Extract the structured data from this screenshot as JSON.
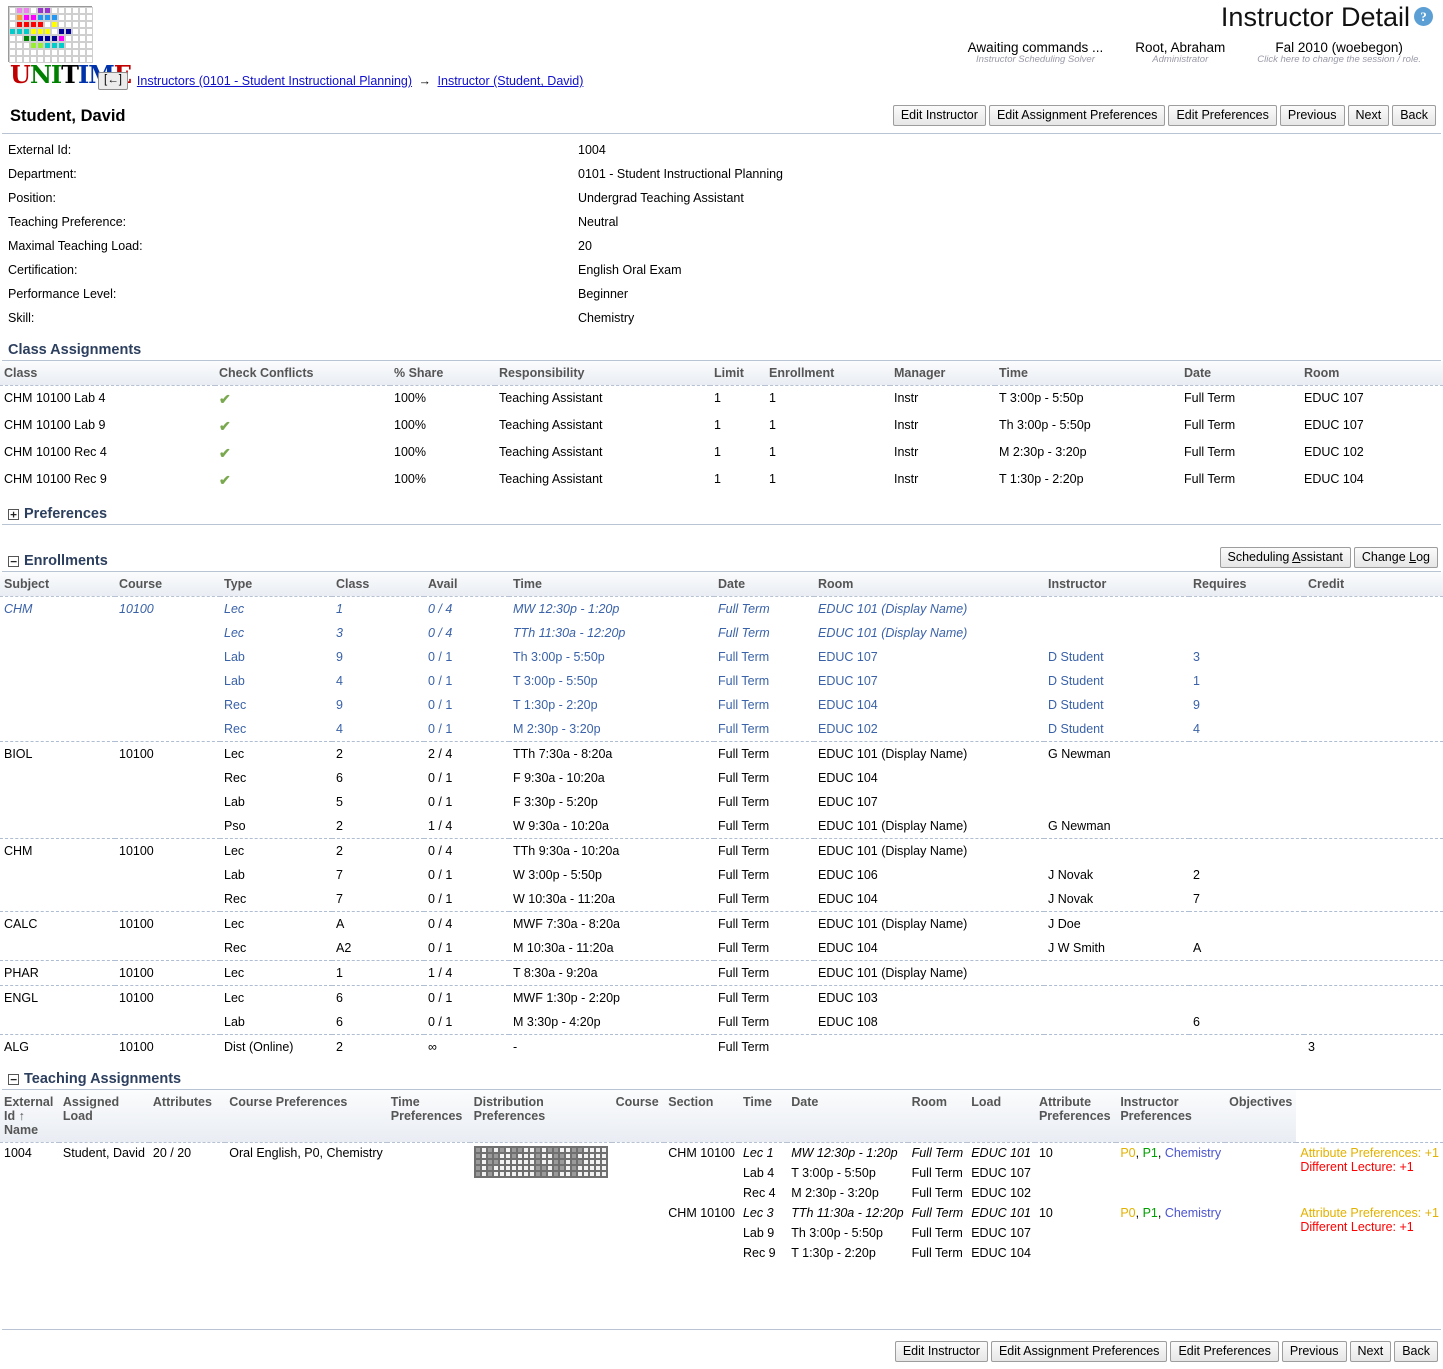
{
  "header": {
    "title": "Instructor Detail",
    "help_icon": "question-mark-icon",
    "status": [
      {
        "main": "Awaiting commands ...",
        "sub": "Instructor Scheduling Solver"
      },
      {
        "main": "Root, Abraham",
        "sub": "Administrator"
      },
      {
        "main": "Fal 2010 (woebegon)",
        "sub": "Click here to change the session / role."
      }
    ],
    "back_button": "[←]",
    "breadcrumb": {
      "first": "Instructors (0101 - Student Instructional Planning)",
      "arrow": "→",
      "second": "Instructor (Student, David)"
    },
    "logo_word": {
      "u": "U",
      "ni": "NI",
      "t": "T",
      "im": "IM",
      "e": "E"
    }
  },
  "person": {
    "name": "Student, David"
  },
  "toolbar": {
    "edit_instructor": "Edit Instructor",
    "edit_assignment_preferences": "Edit Assignment Preferences",
    "edit_preferences": "Edit Preferences",
    "previous": "Previous",
    "next": "Next",
    "back": "Back"
  },
  "properties": [
    {
      "key": "External Id:",
      "value": "1004"
    },
    {
      "key": "Department:",
      "value": "0101 - Student Instructional Planning"
    },
    {
      "key": "Position:",
      "value": "Undergrad Teaching Assistant"
    },
    {
      "key": "Teaching Preference:",
      "value": "Neutral"
    },
    {
      "key": "Maximal Teaching Load:",
      "value": "20"
    },
    {
      "key": "Certification:",
      "value": "English Oral Exam"
    },
    {
      "key": "Performance Level:",
      "value": "Beginner"
    },
    {
      "key": "Skill:",
      "value": "Chemistry"
    }
  ],
  "class_assignments": {
    "section_title": "Class Assignments",
    "columns": [
      "Class",
      "Check Conflicts",
      "% Share",
      "Responsibility",
      "Limit",
      "Enrollment",
      "Manager",
      "Time",
      "Date",
      "Room"
    ],
    "rows": [
      {
        "class": "CHM 10100 Lab 4",
        "conflict": "check-icon",
        "share": "100%",
        "responsibility": "Teaching Assistant",
        "limit": "1",
        "enrollment": "1",
        "manager": "Instr",
        "time": "T 3:00p - 5:50p",
        "date": "Full Term",
        "room": "EDUC 107"
      },
      {
        "class": "CHM 10100 Lab 9",
        "conflict": "check-icon",
        "share": "100%",
        "responsibility": "Teaching Assistant",
        "limit": "1",
        "enrollment": "1",
        "manager": "Instr",
        "time": "Th 3:00p - 5:50p",
        "date": "Full Term",
        "room": "EDUC 107"
      },
      {
        "class": "CHM 10100 Rec 4",
        "conflict": "check-icon",
        "share": "100%",
        "responsibility": "Teaching Assistant",
        "limit": "1",
        "enrollment": "1",
        "manager": "Instr",
        "time": "M 2:30p - 3:20p",
        "date": "Full Term",
        "room": "EDUC 102"
      },
      {
        "class": "CHM 10100 Rec 9",
        "conflict": "check-icon",
        "share": "100%",
        "responsibility": "Teaching Assistant",
        "limit": "1",
        "enrollment": "1",
        "manager": "Instr",
        "time": "T 1:30p - 2:20p",
        "date": "Full Term",
        "room": "EDUC 104"
      }
    ]
  },
  "preferences": {
    "section_title": "Preferences",
    "toggle": "+"
  },
  "enrollments": {
    "section_title": "Enrollments",
    "toggle": "−",
    "scheduling_assistant": "Scheduling Assistant",
    "change_log": "Change Log",
    "columns": [
      "Subject",
      "Course",
      "Type",
      "Class",
      "Avail",
      "Time",
      "Date",
      "Room",
      "Instructor",
      "Requires",
      "Credit"
    ],
    "rows": [
      {
        "group": true,
        "link": true,
        "italic": true,
        "subject": "CHM",
        "course": "10100",
        "type": "Lec",
        "class": "1",
        "avail": "0 / 4",
        "time": "MW 12:30p - 1:20p",
        "date": "Full Term",
        "room": "EDUC 101 (Display Name)",
        "instructor": "",
        "requires": "",
        "credit": ""
      },
      {
        "group": false,
        "link": true,
        "italic": true,
        "subject": "",
        "course": "",
        "type": "Lec",
        "class": "3",
        "avail": "0 / 4",
        "time": "TTh 11:30a - 12:20p",
        "date": "Full Term",
        "room": "EDUC 101 (Display Name)",
        "instructor": "",
        "requires": "",
        "credit": ""
      },
      {
        "group": false,
        "link": true,
        "italic": false,
        "subject": "",
        "course": "",
        "type": "Lab",
        "class": "9",
        "avail": "0 / 1",
        "time": "Th 3:00p - 5:50p",
        "date": "Full Term",
        "room": "EDUC 107",
        "instructor": "D Student",
        "requires": "3",
        "credit": ""
      },
      {
        "group": false,
        "link": true,
        "italic": false,
        "subject": "",
        "course": "",
        "type": "Lab",
        "class": "4",
        "avail": "0 / 1",
        "time": "T 3:00p - 5:50p",
        "date": "Full Term",
        "room": "EDUC 107",
        "instructor": "D Student",
        "requires": "1",
        "credit": ""
      },
      {
        "group": false,
        "link": true,
        "italic": false,
        "subject": "",
        "course": "",
        "type": "Rec",
        "class": "9",
        "avail": "0 / 1",
        "time": "T 1:30p - 2:20p",
        "date": "Full Term",
        "room": "EDUC 104",
        "instructor": "D Student",
        "requires": "9",
        "credit": ""
      },
      {
        "group": false,
        "link": true,
        "italic": false,
        "subject": "",
        "course": "",
        "type": "Rec",
        "class": "4",
        "avail": "0 / 1",
        "time": "M 2:30p - 3:20p",
        "date": "Full Term",
        "room": "EDUC 102",
        "instructor": "D Student",
        "requires": "4",
        "credit": ""
      },
      {
        "group": true,
        "link": false,
        "italic": false,
        "subject": "BIOL",
        "course": "10100",
        "type": "Lec",
        "class": "2",
        "avail": "2 / 4",
        "time": "TTh 7:30a - 8:20a",
        "date": "Full Term",
        "room": "EDUC 101 (Display Name)",
        "instructor": "G Newman",
        "requires": "",
        "credit": ""
      },
      {
        "group": false,
        "link": false,
        "italic": false,
        "subject": "",
        "course": "",
        "type": "Rec",
        "class": "6",
        "avail": "0 / 1",
        "time": "F 9:30a - 10:20a",
        "date": "Full Term",
        "room": "EDUC 104",
        "instructor": "",
        "requires": "",
        "credit": ""
      },
      {
        "group": false,
        "link": false,
        "italic": false,
        "subject": "",
        "course": "",
        "type": "Lab",
        "class": "5",
        "avail": "0 / 1",
        "time": "F 3:30p - 5:20p",
        "date": "Full Term",
        "room": "EDUC 107",
        "instructor": "",
        "requires": "",
        "credit": ""
      },
      {
        "group": false,
        "link": false,
        "italic": false,
        "subject": "",
        "course": "",
        "type": "Pso",
        "class": "2",
        "avail": "1 / 4",
        "time": "W 9:30a - 10:20a",
        "date": "Full Term",
        "room": "EDUC 101 (Display Name)",
        "instructor": "G Newman",
        "requires": "",
        "credit": ""
      },
      {
        "group": true,
        "link": false,
        "italic": false,
        "subject": "CHM",
        "course": "10100",
        "type": "Lec",
        "class": "2",
        "avail": "0 / 4",
        "time": "TTh 9:30a - 10:20a",
        "date": "Full Term",
        "room": "EDUC 101 (Display Name)",
        "instructor": "",
        "requires": "",
        "credit": ""
      },
      {
        "group": false,
        "link": false,
        "italic": false,
        "subject": "",
        "course": "",
        "type": "Lab",
        "class": "7",
        "avail": "0 / 1",
        "time": "W 3:00p - 5:50p",
        "date": "Full Term",
        "room": "EDUC 106",
        "instructor": "J Novak",
        "requires": "2",
        "credit": ""
      },
      {
        "group": false,
        "link": false,
        "italic": false,
        "subject": "",
        "course": "",
        "type": "Rec",
        "class": "7",
        "avail": "0 / 1",
        "time": "W 10:30a - 11:20a",
        "date": "Full Term",
        "room": "EDUC 104",
        "instructor": "J Novak",
        "requires": "7",
        "credit": ""
      },
      {
        "group": true,
        "link": false,
        "italic": false,
        "subject": "CALC",
        "course": "10100",
        "type": "Lec",
        "class": "A",
        "avail": "0 / 4",
        "time": "MWF 7:30a - 8:20a",
        "date": "Full Term",
        "room": "EDUC 101 (Display Name)",
        "instructor": "J Doe",
        "requires": "",
        "credit": ""
      },
      {
        "group": false,
        "link": false,
        "italic": false,
        "subject": "",
        "course": "",
        "type": "Rec",
        "class": "A2",
        "avail": "0 / 1",
        "time": "M 10:30a - 11:20a",
        "date": "Full Term",
        "room": "EDUC 104",
        "instructor": "J W Smith",
        "requires": "A",
        "credit": ""
      },
      {
        "group": true,
        "link": false,
        "italic": false,
        "subject": "PHAR",
        "course": "10100",
        "type": "Lec",
        "class": "1",
        "avail": "1 / 4",
        "time": "T 8:30a - 9:20a",
        "date": "Full Term",
        "room": "EDUC 101 (Display Name)",
        "instructor": "",
        "requires": "",
        "credit": ""
      },
      {
        "group": true,
        "link": false,
        "italic": false,
        "subject": "ENGL",
        "course": "10100",
        "type": "Lec",
        "class": "6",
        "avail": "0 / 1",
        "time": "MWF 1:30p - 2:20p",
        "date": "Full Term",
        "room": "EDUC 103",
        "instructor": "",
        "requires": "",
        "credit": ""
      },
      {
        "group": false,
        "link": false,
        "italic": false,
        "subject": "",
        "course": "",
        "type": "Lab",
        "class": "6",
        "avail": "0 / 1",
        "time": "M 3:30p - 4:20p",
        "date": "Full Term",
        "room": "EDUC 108",
        "instructor": "",
        "requires": "6",
        "credit": ""
      },
      {
        "group": true,
        "link": false,
        "italic": false,
        "subject": "ALG",
        "course": "10100",
        "type": "Dist (Online)",
        "class": "2",
        "avail": "∞",
        "time": "-",
        "date": "Full Term",
        "room": "",
        "instructor": "",
        "requires": "",
        "credit": "3"
      }
    ]
  },
  "teaching_assignments": {
    "section_title": "Teaching Assignments",
    "toggle": "−",
    "columns": [
      "External Id ↑ Name",
      "Assigned Load",
      "Attributes",
      "Course Preferences",
      "Time Preferences",
      "Distribution Preferences",
      "Course",
      "Section",
      "Time",
      "Date",
      "Room",
      "Load",
      "Attribute Preferences",
      "Instructor Preferences",
      "Objectives"
    ],
    "external_id": "1004",
    "name": "Student, David",
    "assigned_load": "20 / 20",
    "attributes": "Oral English, P0, Chemistry",
    "course_preferences": "",
    "distribution_preferences": "",
    "instructor_preferences": "",
    "time_pref_grid": {
      "rows": 5,
      "cols": 22,
      "pattern": [
        [
          1,
          0,
          1,
          0,
          1,
          0,
          1,
          1,
          0,
          0,
          1,
          0,
          1,
          1,
          0,
          0,
          1,
          1,
          0,
          0,
          0,
          0
        ],
        [
          1,
          0,
          1,
          1,
          0,
          0,
          1,
          0,
          0,
          0,
          1,
          0,
          0,
          1,
          1,
          0,
          1,
          0,
          0,
          0,
          0,
          0
        ],
        [
          1,
          0,
          1,
          1,
          0,
          0,
          0,
          0,
          0,
          0,
          1,
          0,
          0,
          1,
          1,
          0,
          1,
          1,
          0,
          0,
          0,
          0
        ],
        [
          1,
          0,
          1,
          0,
          0,
          0,
          0,
          0,
          0,
          0,
          1,
          1,
          0,
          1,
          1,
          0,
          1,
          0,
          0,
          0,
          0,
          0
        ],
        [
          1,
          0,
          1,
          0,
          0,
          0,
          0,
          0,
          0,
          0,
          1,
          1,
          0,
          1,
          0,
          0,
          1,
          0,
          0,
          0,
          0,
          0
        ]
      ]
    },
    "groups": [
      {
        "course": "CHM 10100",
        "load": "10",
        "attribute_preferences": [
          {
            "text": "P0",
            "color": "#e3b200"
          },
          {
            "text": "P1",
            "color": "#00a000"
          },
          {
            "text": "Chemistry",
            "color": "#4b54cf"
          }
        ],
        "objectives": [
          {
            "text": "Attribute Preferences: +1",
            "color": "#e3b200"
          },
          {
            "text": "Different Lecture: +1",
            "color": "#ff0000"
          }
        ],
        "sections": [
          {
            "section": "Lec 1",
            "time": "MW 12:30p - 1:20p",
            "date": "Full Term",
            "room": "EDUC 101",
            "italic": true
          },
          {
            "section": "Lab 4",
            "time": "T 3:00p - 5:50p",
            "date": "Full Term",
            "room": "EDUC 107",
            "italic": false
          },
          {
            "section": "Rec 4",
            "time": "M 2:30p - 3:20p",
            "date": "Full Term",
            "room": "EDUC 102",
            "italic": false
          }
        ]
      },
      {
        "course": "CHM 10100",
        "load": "10",
        "attribute_preferences": [
          {
            "text": "P0",
            "color": "#e3b200"
          },
          {
            "text": "P1",
            "color": "#00a000"
          },
          {
            "text": "Chemistry",
            "color": "#4b54cf"
          }
        ],
        "objectives": [
          {
            "text": "Attribute Preferences: +1",
            "color": "#e3b200"
          },
          {
            "text": "Different Lecture: +1",
            "color": "#ff0000"
          }
        ],
        "sections": [
          {
            "section": "Lec 3",
            "time": "TTh 11:30a - 12:20p",
            "date": "Full Term",
            "room": "EDUC 101",
            "italic": true
          },
          {
            "section": "Lab 9",
            "time": "Th 3:00p - 5:50p",
            "date": "Full Term",
            "room": "EDUC 107",
            "italic": false
          },
          {
            "section": "Rec 9",
            "time": "T 1:30p - 2:20p",
            "date": "Full Term",
            "room": "EDUC 104",
            "italic": false
          }
        ]
      }
    ]
  },
  "logo_colors": [
    [
      "#ffffff",
      "#ee82ee",
      "#ee82ee",
      "#ffffff",
      "#9933cc",
      "#9933cc",
      "#ffffff",
      "#ffffff",
      "#ffffff",
      "#ffffff",
      "#ffffff",
      "#ffffff"
    ],
    [
      "#ffffff",
      "#ff9933",
      "#ff00ff",
      "#ff00ff",
      "#2196f3",
      "#2196f3",
      "#2196f3",
      "#ffffff",
      "#ffffff",
      "#ffffff",
      "#ffffff",
      "#ffffff"
    ],
    [
      "#ffffff",
      "#ff0000",
      "#ff0000",
      "#ff0000",
      "#ff0000",
      "#ffffff",
      "#ffff00",
      "#ffffff",
      "#ffffff",
      "#ffffff",
      "#ffffff",
      "#ffffff"
    ],
    [
      "#00cccc",
      "#00cccc",
      "#00cccc",
      "#ffff00",
      "#ffff00",
      "#ffff00",
      "#ffffff",
      "#000099",
      "#000099",
      "#ffffff",
      "#ffffff",
      "#ffffff"
    ],
    [
      "#ffffff",
      "#ffffff",
      "#008000",
      "#008000",
      "#000099",
      "#000099",
      "#000099",
      "#ff00ff",
      "#ffffff",
      "#ffffff",
      "#ffffff",
      "#ffffff"
    ],
    [
      "#ffffff",
      "#ffffff",
      "#ffffff",
      "#99ee33",
      "#99ee33",
      "#00cccc",
      "#00cccc",
      "#00cccc",
      "#ffffff",
      "#ffffff",
      "#ffffff",
      "#ffffff"
    ]
  ]
}
